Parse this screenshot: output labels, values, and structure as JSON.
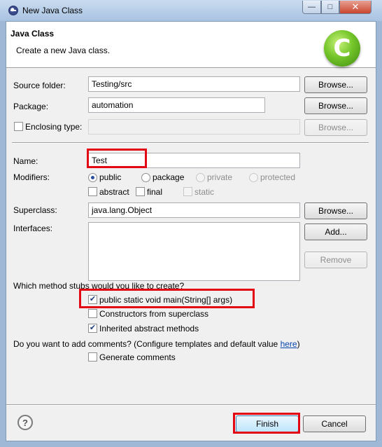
{
  "window": {
    "title": "New Java Class"
  },
  "header": {
    "title": "Java Class",
    "description": "Create a new Java class.",
    "icon": "java-class-icon"
  },
  "form": {
    "source_folder": {
      "label": "Source folder:",
      "value": "Testing/src",
      "browse": "Browse..."
    },
    "package": {
      "label": "Package:",
      "value": "automation",
      "browse": "Browse..."
    },
    "enclosing_type": {
      "label": "Enclosing type:",
      "value": "",
      "browse": "Browse..."
    },
    "name": {
      "label": "Name:",
      "value": "Test"
    },
    "modifiers": {
      "label": "Modifiers:",
      "public": "public",
      "package": "package",
      "private": "private",
      "protected": "protected",
      "abstract": "abstract",
      "final": "final",
      "static": "static"
    },
    "superclass": {
      "label": "Superclass:",
      "value": "java.lang.Object",
      "browse": "Browse..."
    },
    "interfaces": {
      "label": "Interfaces:",
      "add": "Add...",
      "remove": "Remove"
    }
  },
  "stubs": {
    "question": "Which method stubs would you like to create?",
    "main": "public static void main(String[] args)",
    "constructors": "Constructors from superclass",
    "inherited": "Inherited abstract methods"
  },
  "comments": {
    "question_prefix": "Do you want to add comments? (Configure templates and default value ",
    "link": "here",
    "question_suffix": ")",
    "generate": "Generate comments"
  },
  "footer": {
    "finish": "Finish",
    "cancel": "Cancel"
  },
  "colors": {
    "highlight": "#e30613",
    "accent": "#3c7fb1"
  }
}
